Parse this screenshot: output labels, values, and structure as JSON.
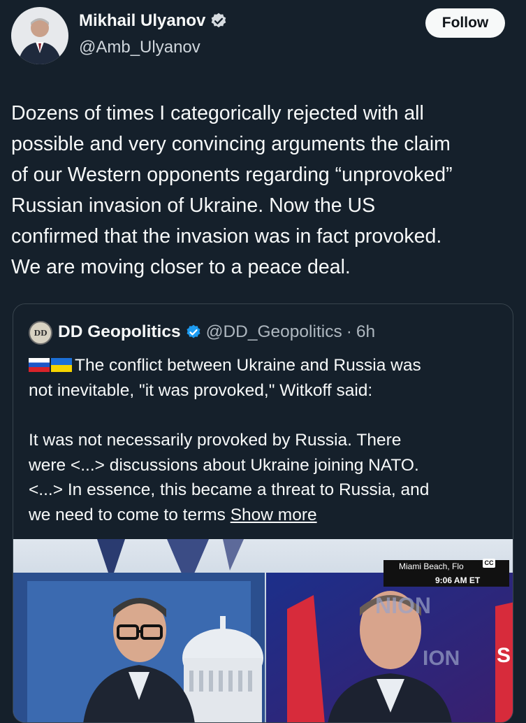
{
  "author": {
    "name": "Mikhail Ulyanov",
    "handle": "@Amb_Ulyanov",
    "follow_label": "Follow"
  },
  "post": {
    "text": "Dozens of times I categorically rejected with all\npossible and very convincing arguments the claim\nof our Western opponents regarding “unprovoked”\nRussian invasion of Ukraine. Now the US\nconfirmed that the invasion was in fact  provoked.\nWe are moving closer to a peace deal."
  },
  "quote": {
    "avatar_text": "DD",
    "name": "DD Geopolitics",
    "handle": "@DD_Geopolitics",
    "separator": "·",
    "time": "6h",
    "line1": "The conflict between Ukraine and Russia was",
    "line2": "not inevitable, \"it was provoked,\" Witkoff said:",
    "line3": "It was not necessarily provoked by Russia. There",
    "line4": "were <...> discussions about Ukraine joining NATO.",
    "line5": "<...> In essence, this became a threat to Russia, and",
    "line6_prefix": "we need to come to terms ",
    "show_more": "Show more"
  },
  "media": {
    "location": "Miami Beach, Flo",
    "time": "9:06 AM ET",
    "cc": "CC",
    "bg_text_1": "NION",
    "bg_text_2": "ION",
    "bg_text_3": "S"
  },
  "colors": {
    "background": "#15202b",
    "verified": "#1d9bf0"
  }
}
